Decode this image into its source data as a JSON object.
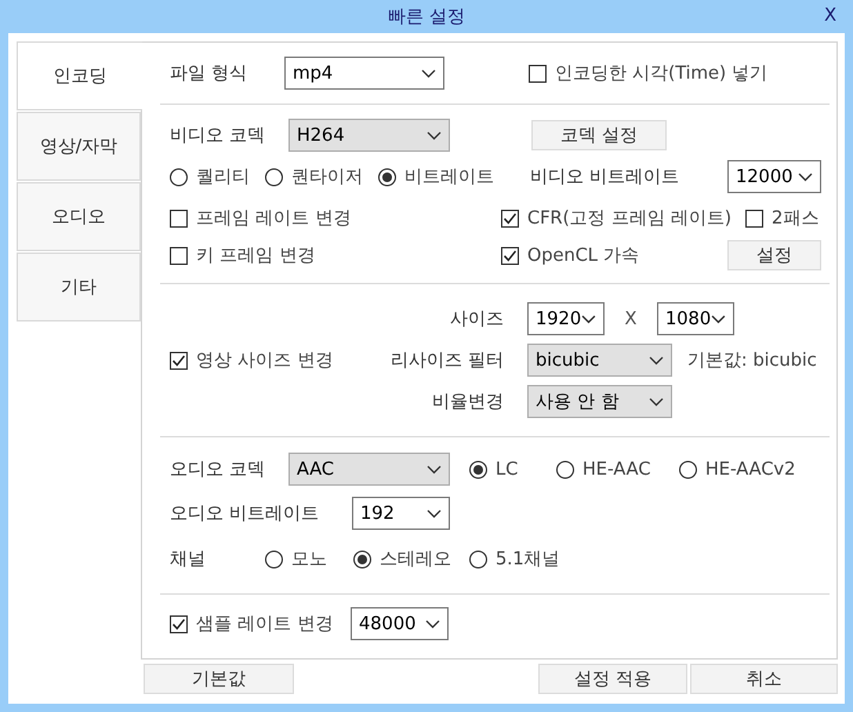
{
  "window": {
    "title": "빠른 설정",
    "close": "X"
  },
  "tabs": [
    {
      "label": "인코딩",
      "selected": true
    },
    {
      "label": "영상/자막",
      "selected": false
    },
    {
      "label": "오디오",
      "selected": false
    },
    {
      "label": "기타",
      "selected": false
    }
  ],
  "file_format": {
    "label": "파일 형식",
    "value": "mp4",
    "editable": true
  },
  "insert_time": {
    "label": "인코딩한 시각(Time) 넣기",
    "checked": false
  },
  "video": {
    "codec": {
      "label": "비디오 코덱",
      "value": "H264",
      "editable": false
    },
    "codec_button": "코덱 설정",
    "rate_modes": [
      {
        "label": "퀄리티",
        "selected": false
      },
      {
        "label": "퀀타이저",
        "selected": false
      },
      {
        "label": "비트레이트",
        "selected": true
      }
    ],
    "bitrate": {
      "label": "비디오 비트레이트",
      "value": "12000",
      "editable": true
    },
    "frame_rate": {
      "label": "프레임 레이트 변경",
      "checked": false
    },
    "cfr": {
      "label": "CFR(고정 프레임 레이트)",
      "checked": true
    },
    "two_pass": {
      "label": "2패스",
      "checked": false
    },
    "key_frame": {
      "label": "키 프레임 변경",
      "checked": false
    },
    "opencl": {
      "label": "OpenCL 가속",
      "checked": true
    },
    "opencl_button": "설정"
  },
  "resize": {
    "size_label": "사이즈",
    "width": {
      "value": "1920",
      "editable": true
    },
    "separator": "X",
    "height": {
      "value": "1080",
      "editable": true
    },
    "enabled": {
      "label": "영상 사이즈 변경",
      "checked": true
    },
    "filter": {
      "label": "리사이즈 필터",
      "value": "bicubic",
      "editable": false
    },
    "filter_default": "기본값: bicubic",
    "aspect": {
      "label": "비율변경",
      "value": "사용 안 함",
      "editable": false
    }
  },
  "audio": {
    "codec": {
      "label": "오디오 코덱",
      "value": "AAC",
      "editable": false
    },
    "profiles": [
      {
        "label": "LC",
        "selected": true
      },
      {
        "label": "HE-AAC",
        "selected": false
      },
      {
        "label": "HE-AACv2",
        "selected": false
      }
    ],
    "bitrate": {
      "label": "오디오 비트레이트",
      "value": "192",
      "editable": true
    },
    "channel_label": "채널",
    "channels": [
      {
        "label": "모노",
        "selected": false
      },
      {
        "label": "스테레오",
        "selected": true
      },
      {
        "label": "5.1채널",
        "selected": false
      }
    ]
  },
  "sample_rate": {
    "label": "샘플 레이트 변경",
    "checked": true,
    "value": "48000",
    "editable": true
  },
  "buttons": [
    "기본값",
    "설정 적용",
    "취소"
  ]
}
